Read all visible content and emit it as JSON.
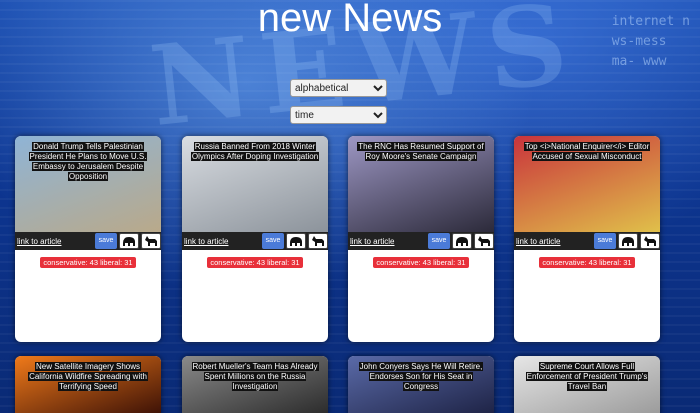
{
  "page": {
    "title": "new News"
  },
  "background": {
    "word": "NEWS",
    "ticker_lines": [
      "internet n",
      "ws-mess",
      "ma- www"
    ]
  },
  "controls": {
    "sort_select": {
      "value": "alphabetical",
      "options": [
        "alphabetical"
      ]
    },
    "time_select": {
      "value": "time",
      "options": [
        "time"
      ]
    }
  },
  "labels": {
    "link": "link to article",
    "save": "save"
  },
  "colors": {
    "save_button": "#4b7bd8",
    "score_badge": "#e8303a",
    "action_bar": "#222222"
  },
  "articles": [
    {
      "headline": "Donald Trump Tells Palestinian President He Plans to Move U.S. Embassy to Jerusalem Despite Opposition",
      "score": "conservative: 43 liberal: 31",
      "thumb": [
        "#8fb4d6",
        "#b9a98a"
      ]
    },
    {
      "headline": "Russia Banned From 2018 Winter Olympics After Doping Investigation",
      "score": "conservative: 43 liberal: 31",
      "thumb": [
        "#d9dde2",
        "#8c939b"
      ]
    },
    {
      "headline": "The RNC Has Resumed Support of Roy Moore's Senate Campaign",
      "score": "conservative: 43 liberal: 31",
      "thumb": [
        "#9d97c4",
        "#2c2a3a"
      ]
    },
    {
      "headline": "Top <i>National Enquirer</i> Editor Accused of Sexual Misconduct",
      "score": "conservative: 43 liberal: 31",
      "thumb": [
        "#c9333c",
        "#e0c04a"
      ]
    },
    {
      "headline": "New Satellite Imagery Shows California Wildfire Spreading with Terrifying Speed",
      "thumb": [
        "#f07a1a",
        "#3a1006"
      ]
    },
    {
      "headline": "Robert Mueller's Team Has Already Spent Millions on the Russia Investigation",
      "thumb": [
        "#8a8a8a",
        "#2a2a2a"
      ]
    },
    {
      "headline": "John Conyers Says He Will Retire, Endorses Son for His Seat in Congress",
      "thumb": [
        "#5a6aa8",
        "#1d2244"
      ]
    },
    {
      "headline": "Supreme Court Allows Full Enforcement of President Trump's Travel Ban",
      "thumb": [
        "#e6e6e6",
        "#9a9a9a"
      ]
    }
  ]
}
